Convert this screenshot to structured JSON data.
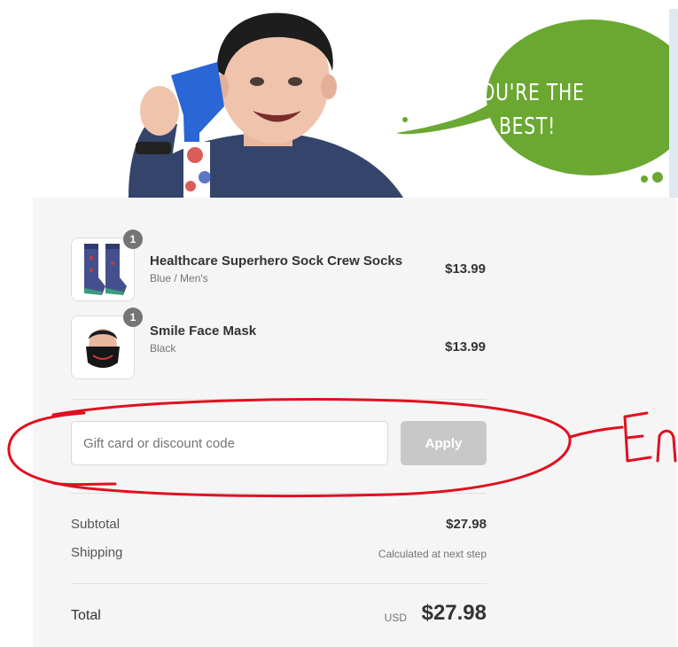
{
  "banner": {
    "bubble_line1": "YOU'RE THE",
    "bubble_line2": "BEST!",
    "bubble_color": "#6aa832"
  },
  "cart": {
    "items": [
      {
        "name": "Healthcare Superhero Sock Crew Socks",
        "variant": "Blue / Men's",
        "price": "$13.99",
        "quantity": "1"
      },
      {
        "name": "Smile Face Mask",
        "variant": "Black",
        "price": "$13.99",
        "quantity": "1"
      }
    ]
  },
  "discount": {
    "placeholder": "Gift card or discount code",
    "apply_label": "Apply"
  },
  "summary": {
    "subtotal_label": "Subtotal",
    "subtotal_value": "$27.98",
    "shipping_label": "Shipping",
    "shipping_value": "Calculated at next step",
    "total_label": "Total",
    "currency": "USD",
    "total_value": "$27.98"
  },
  "annotation": {
    "scribble_text": "En",
    "color": "#e01020"
  }
}
